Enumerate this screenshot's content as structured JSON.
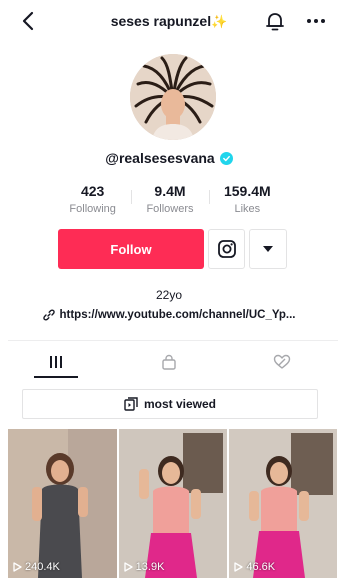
{
  "header": {
    "title": "seses rapunzel",
    "title_emoji": "✨"
  },
  "profile": {
    "handle": "@realsesesvana",
    "verified": true
  },
  "stats": [
    {
      "value": "423",
      "label": "Following"
    },
    {
      "value": "9.4M",
      "label": "Followers"
    },
    {
      "value": "159.4M",
      "label": "Likes"
    }
  ],
  "actions": {
    "follow_label": "Follow"
  },
  "bio": {
    "text": "22yo",
    "link": "https://www.youtube.com/channel/UC_Yp..."
  },
  "tabs": [
    {
      "icon": "grid-icon",
      "active": true
    },
    {
      "icon": "lock-icon",
      "active": false
    },
    {
      "icon": "liked-icon",
      "active": false
    }
  ],
  "sort": {
    "label": "most viewed"
  },
  "videos": [
    {
      "views": "240.4K"
    },
    {
      "views": "13.9K"
    },
    {
      "views": "46.6K"
    }
  ],
  "colors": {
    "accent": "#fe2c55",
    "verified": "#20d5ec",
    "text": "#161823",
    "muted": "#8a8b91"
  }
}
